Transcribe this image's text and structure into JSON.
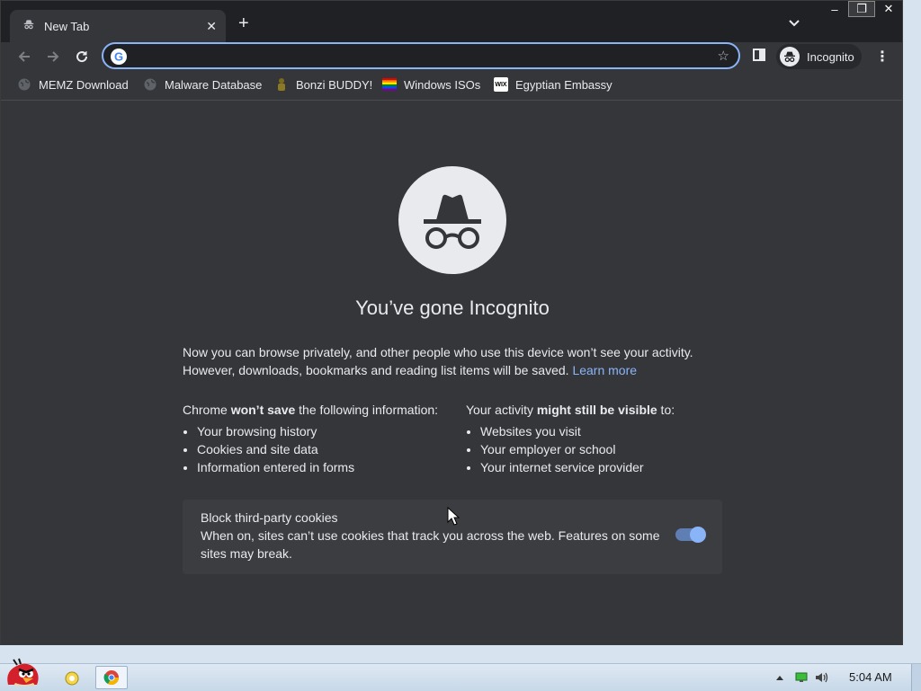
{
  "window": {
    "controls": {
      "minimize": "‒",
      "maximize": "❐",
      "close": "✕"
    }
  },
  "tab": {
    "title": "New Tab",
    "close_glyph": "✕",
    "new_tab_glyph": "+",
    "search_glyph": "⌄"
  },
  "toolbar": {
    "back": "←",
    "forward": "→",
    "reload": "↻",
    "omnibox_value": "",
    "star": "☆",
    "incognito_label": "Incognito",
    "menu": "⋮"
  },
  "bookmarks": [
    {
      "label": "MEMZ Download",
      "icon": "globe-icon"
    },
    {
      "label": "Malware Database",
      "icon": "globe-icon"
    },
    {
      "label": "Bonzi BUDDY!",
      "icon": "bonzi-icon"
    },
    {
      "label": "Windows ISOs",
      "icon": "rainbow-flag-icon"
    },
    {
      "label": "Egyptian Embassy",
      "icon": "wix-icon",
      "icon_text": "WIX"
    }
  ],
  "content": {
    "heading": "You’ve gone Incognito",
    "intro_text": "Now you can browse privately, and other people who use this device won’t see your activity. However, downloads, bookmarks and reading list items will be saved.",
    "learn_more": "Learn more",
    "left_col": {
      "heading_pre": "Chrome ",
      "heading_bold": "won’t save",
      "heading_post": " the following information:",
      "items": [
        "Your browsing history",
        "Cookies and site data",
        "Information entered in forms"
      ]
    },
    "right_col": {
      "heading_pre": "Your activity ",
      "heading_bold": "might still be visible",
      "heading_post": " to:",
      "items": [
        "Websites you visit",
        "Your employer or school",
        "Your internet service provider"
      ]
    },
    "cookies": {
      "title": "Block third-party cookies",
      "description": "When on, sites can’t use cookies that track you across the web. Features on some sites may break.",
      "enabled": true
    }
  },
  "taskbar": {
    "clock": "5:04 AM"
  },
  "colors": {
    "accent": "#8ab4f8",
    "toolbar": "#35363a",
    "tabstrip": "#202124"
  }
}
